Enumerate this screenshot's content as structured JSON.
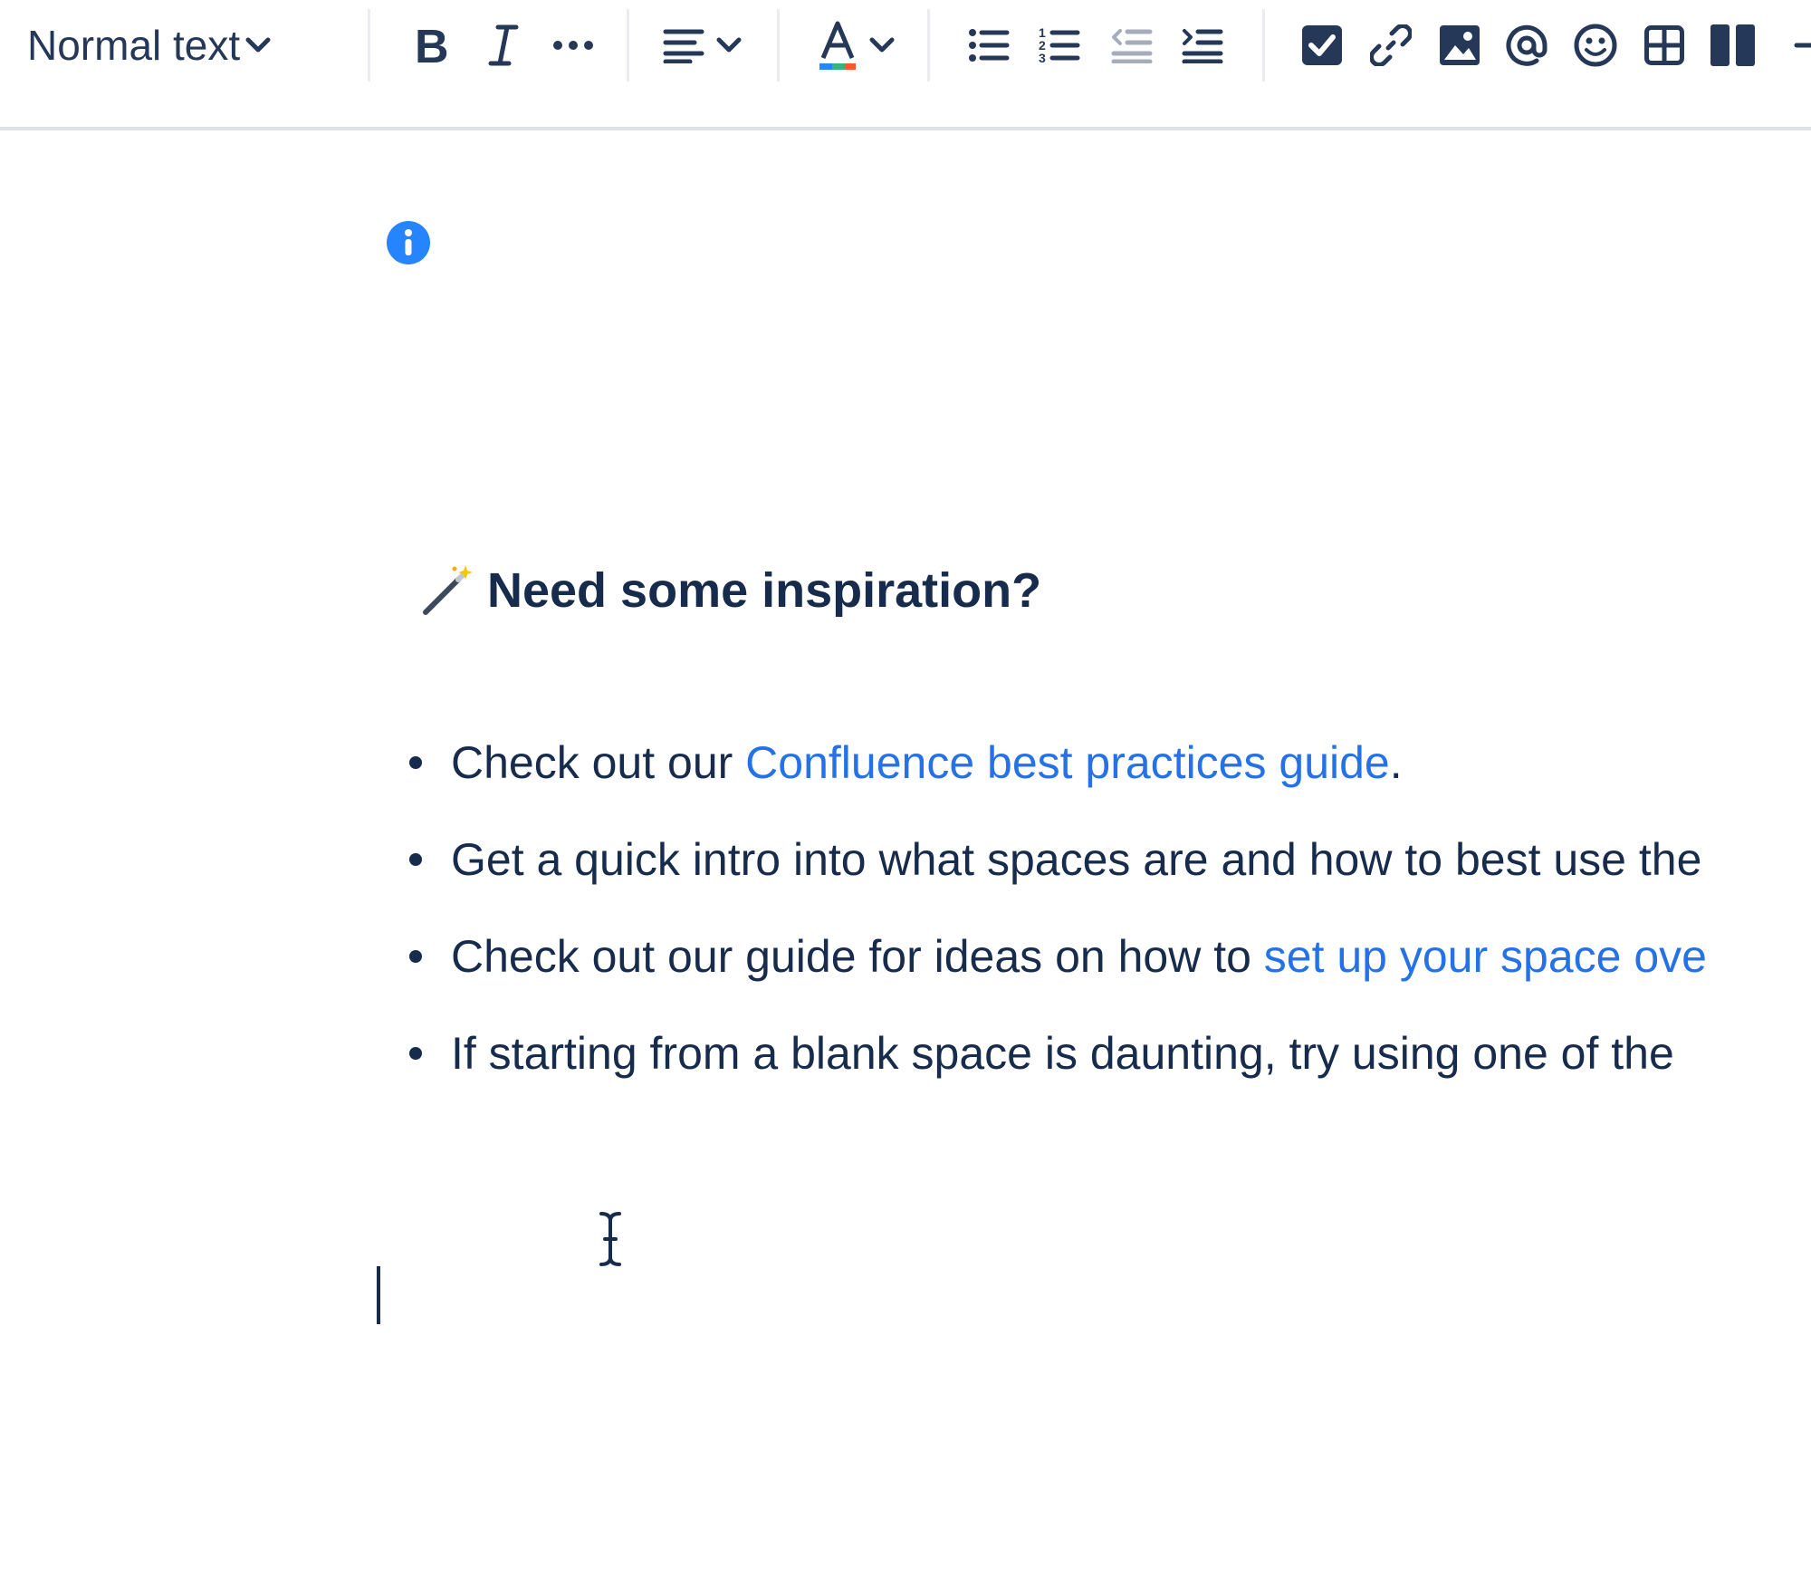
{
  "toolbar": {
    "text_style": "Normal text",
    "buttons": {
      "bold": "bold-icon",
      "italic": "italic-icon",
      "more_formatting": "more-icon",
      "alignment": "align-left-icon",
      "text_color": "text-color-icon",
      "bullet_list": "bullet-list-icon",
      "numbered_list": "numbered-list-icon",
      "outdent": "outdent-icon",
      "indent": "indent-icon",
      "action_item": "checkbox-icon",
      "link": "link-icon",
      "image": "image-icon",
      "mention": "mention-icon",
      "emoji": "emoji-icon",
      "table": "table-icon",
      "layouts": "layout-columns-icon"
    },
    "colors": {
      "icon": "#253858",
      "outdent_disabled": "#a5adba"
    }
  },
  "editor": {
    "heading": "Need some inspiration?",
    "bullets": [
      {
        "before": "Check out our ",
        "link": "Confluence best practices guide",
        "after": "."
      },
      {
        "before": "Get a quick intro into what spaces are and how to best use the",
        "link": "",
        "after": ""
      },
      {
        "before": "Check out our guide for ideas on how to ",
        "link": "set up your space ove",
        "after": ""
      },
      {
        "before": "If starting from a blank space is daunting, try using one of the",
        "link": "",
        "after": ""
      }
    ],
    "colors": {
      "text": "#172b4d",
      "link": "#2572e6",
      "info": "#2684ff"
    }
  }
}
